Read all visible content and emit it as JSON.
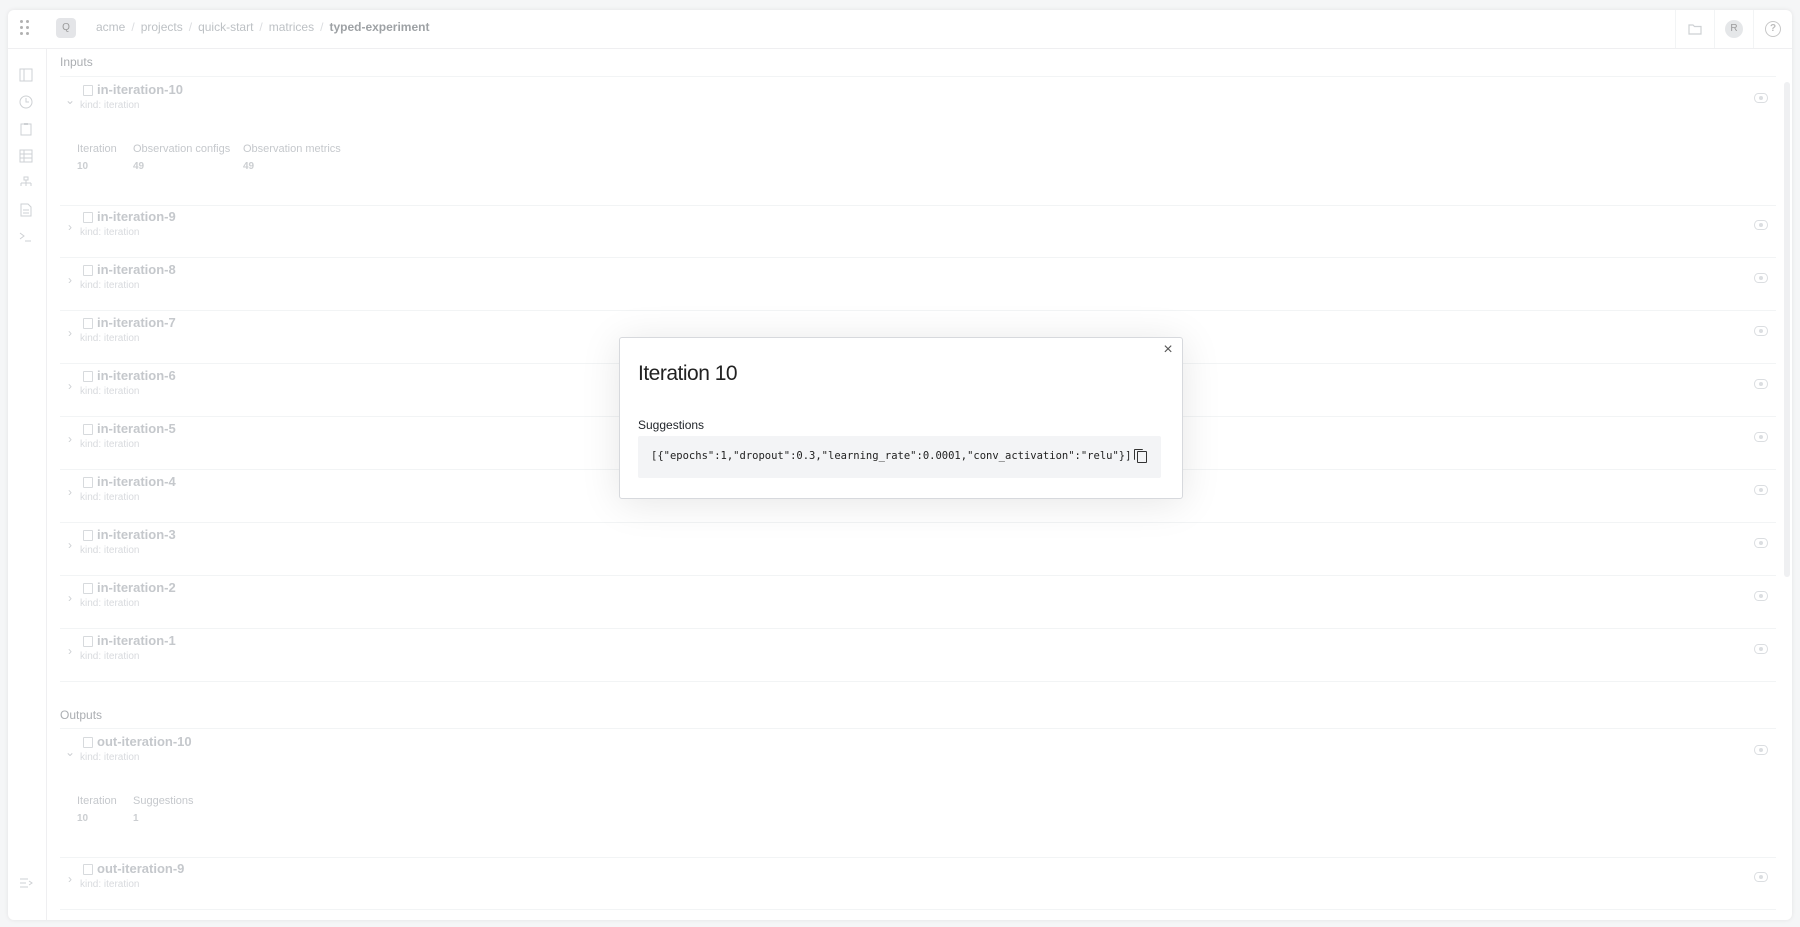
{
  "breadcrumb": {
    "logo_letter": "Q",
    "items": [
      "acme",
      "projects",
      "quick-start",
      "matrices",
      "typed-experiment"
    ],
    "separator": "/"
  },
  "topbar": {
    "avatar_letter": "R",
    "help_label": "?"
  },
  "inputs": {
    "label": "Inputs",
    "rows": [
      {
        "name": "in-iteration-10",
        "kind": "kind: iteration",
        "expanded": true,
        "meta": [
          {
            "label": "Iteration",
            "value": "10"
          },
          {
            "label": "Observation configs",
            "value": "49"
          },
          {
            "label": "Observation metrics",
            "value": "49"
          }
        ]
      },
      {
        "name": "in-iteration-9",
        "kind": "kind: iteration"
      },
      {
        "name": "in-iteration-8",
        "kind": "kind: iteration"
      },
      {
        "name": "in-iteration-7",
        "kind": "kind: iteration"
      },
      {
        "name": "in-iteration-6",
        "kind": "kind: iteration"
      },
      {
        "name": "in-iteration-5",
        "kind": "kind: iteration"
      },
      {
        "name": "in-iteration-4",
        "kind": "kind: iteration"
      },
      {
        "name": "in-iteration-3",
        "kind": "kind: iteration"
      },
      {
        "name": "in-iteration-2",
        "kind": "kind: iteration"
      },
      {
        "name": "in-iteration-1",
        "kind": "kind: iteration"
      }
    ]
  },
  "outputs": {
    "label": "Outputs",
    "rows": [
      {
        "name": "out-iteration-10",
        "kind": "kind: iteration",
        "expanded": true,
        "meta": [
          {
            "label": "Iteration",
            "value": "10"
          },
          {
            "label": "Suggestions",
            "value": "1"
          }
        ]
      },
      {
        "name": "out-iteration-9",
        "kind": "kind: iteration"
      }
    ]
  },
  "modal": {
    "title": "Iteration 10",
    "section_label": "Suggestions",
    "code": "[{\"epochs\":1,\"dropout\":0.3,\"learning_rate\":0.0001,\"conv_activation\":\"relu\"}]",
    "close_label": "×"
  },
  "icons": {
    "app_menu": "grid-dots-icon",
    "sidebar": [
      "panel-icon",
      "clock-icon",
      "clipboard-icon",
      "table-icon",
      "hierarchy-icon",
      "document-icon",
      "terminal-icon"
    ],
    "bottom": "collapse-menu-icon",
    "row_icon": "matrix-icon",
    "row_view": "eye-icon",
    "copy": "copy-icon",
    "folder": "folder-icon"
  }
}
